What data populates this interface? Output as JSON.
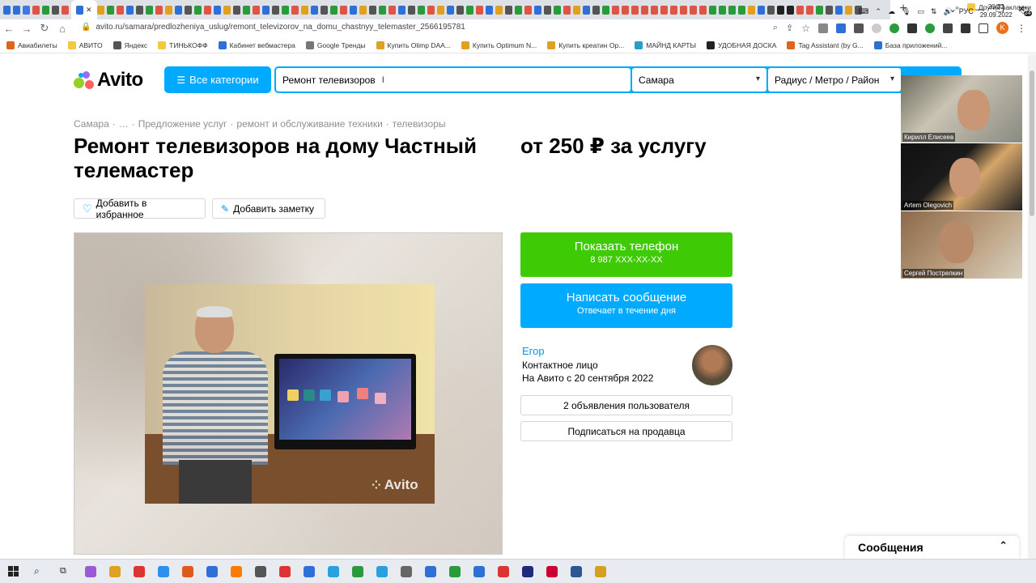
{
  "browser": {
    "url": "avito.ru/samara/predlozheniya_uslug/remont_televizorov_na_domu_chastnyy_telemaster_2566195781",
    "tab_colors": [
      "#2f6fd8",
      "#2f6fd8",
      "#3b7be0",
      "#d54",
      "#2a9a3a",
      "#555",
      "#d54",
      "#2f6fd8",
      "#e0a020",
      "#2a9a3a",
      "#d54",
      "#2f6fd8",
      "#555",
      "#2a9a3a",
      "#d54",
      "#e0a020",
      "#2f6fd8",
      "#555",
      "#2a9a3a",
      "#d54",
      "#2f6fd8",
      "#e0a020",
      "#555",
      "#2a9a3a",
      "#d54",
      "#2f6fd8",
      "#555",
      "#2a9a3a",
      "#d54",
      "#e0a020",
      "#2f6fd8",
      "#555",
      "#2a9a3a",
      "#d54",
      "#2f6fd8",
      "#e0a020",
      "#555",
      "#2a9a3a",
      "#d54",
      "#2f6fd8",
      "#555",
      "#2a9a3a",
      "#d54",
      "#e0a020",
      "#2f6fd8",
      "#555",
      "#2a9a3a",
      "#d54",
      "#2f6fd8",
      "#e0a020",
      "#555",
      "#2a9a3a",
      "#d54",
      "#2f6fd8",
      "#555",
      "#2a9a3a",
      "#d54",
      "#e0a020",
      "#2f6fd8",
      "#555",
      "#2a9a3a",
      "#d54",
      "#d54",
      "#d54",
      "#d54",
      "#d54",
      "#d54",
      "#d54",
      "#d54",
      "#d54",
      "#d54",
      "#2a9a3a",
      "#2a9a3a",
      "#2a9a3a",
      "#2a9a3a",
      "#e0a020",
      "#2f6fd8",
      "#555",
      "#222",
      "#222",
      "#d54",
      "#d54",
      "#2a9a3a",
      "#555",
      "#2f6fd8",
      "#e0a020",
      "#555"
    ],
    "new_tab_label": "+",
    "window_controls": [
      "⌄",
      "—",
      "❐",
      "✕"
    ],
    "profile_letter": "K"
  },
  "bookmarks": {
    "items": [
      {
        "label": "Авиабилеты",
        "color": "#e0641e"
      },
      {
        "label": "АВИТО",
        "color": "#f5c842"
      },
      {
        "label": "Яндекс",
        "color": "#555"
      },
      {
        "label": "ТИНЬКОФФ",
        "color": "#f5c842"
      },
      {
        "label": "Кабинет вебмастера",
        "color": "#2f6fd8"
      },
      {
        "label": "Google Тренды",
        "color": "#777"
      },
      {
        "label": "Купить Olimp DAA...",
        "color": "#e0a020"
      },
      {
        "label": "Купить Optimum N...",
        "color": "#e0a020"
      },
      {
        "label": "Купить креатин Op...",
        "color": "#e0a020"
      },
      {
        "label": "МАЙНД КАРТЫ",
        "color": "#2aa0c8"
      },
      {
        "label": "УДОБНАЯ ДОСКА",
        "color": "#222"
      },
      {
        "label": "Tag Assistant (by G...",
        "color": "#e0641e"
      },
      {
        "label": "База приложений...",
        "color": "#2f6fd8"
      }
    ],
    "more_label": "»",
    "other_label": "Другие закладки"
  },
  "header": {
    "logo_text": "Avito",
    "all_categories_label": "Все категории",
    "search_value": "Ремонт телевизоров",
    "city_value": "Самара",
    "radius_value": "Радиус / Метро / Район"
  },
  "breadcrumbs": [
    "Самара",
    "·",
    "…",
    "·",
    "Предложение услуг",
    "·",
    "ремонт и обслуживание техники",
    "·",
    "телевизоры"
  ],
  "listing": {
    "title": "Ремонт телевизоров на дому Частный телемастер",
    "price": "от 250 ₽ за услугу",
    "favorite_label": "Добавить в избранное",
    "note_label": "Добавить заметку",
    "watermark": "Avito"
  },
  "contact": {
    "show_phone_label": "Показать телефон",
    "phone_masked": "8 987 XXX-XX-XX",
    "write_label": "Написать сообщение",
    "write_sub": "Отвечает в течение дня"
  },
  "seller": {
    "name": "Егор",
    "role": "Контактное лицо",
    "since": "На Авито с 20 сентября 2022",
    "ads_label": "2 объявления пользователя",
    "subscribe_label": "Подписаться на продавца"
  },
  "messages_panel": {
    "label": "Сообщения",
    "toggle": "⌃"
  },
  "video_call": {
    "participants": [
      {
        "name": "Кирилл Елисеев"
      },
      {
        "name": "Artem Olegovich"
      },
      {
        "name": "Сергей Пострелкин"
      }
    ]
  },
  "taskbar": {
    "app_colors": [
      "#9b59d6",
      "#e0a020",
      "#d33",
      "#2f8ff0",
      "#e05a1e",
      "#2f6fd8",
      "#ff7a00",
      "#555",
      "#d33",
      "#2f6fd8",
      "#2aa0e0",
      "#2a9a3a",
      "#2aa0e0",
      "#666",
      "#2f6fd8",
      "#2a9a3a",
      "#2f6fd8",
      "#d33",
      "#1c2c7a",
      "#c03",
      "#2b5797",
      "#d4a020"
    ],
    "language": "РУС",
    "time": "20:32",
    "date": "29.09.2022",
    "notification_count": "24"
  }
}
